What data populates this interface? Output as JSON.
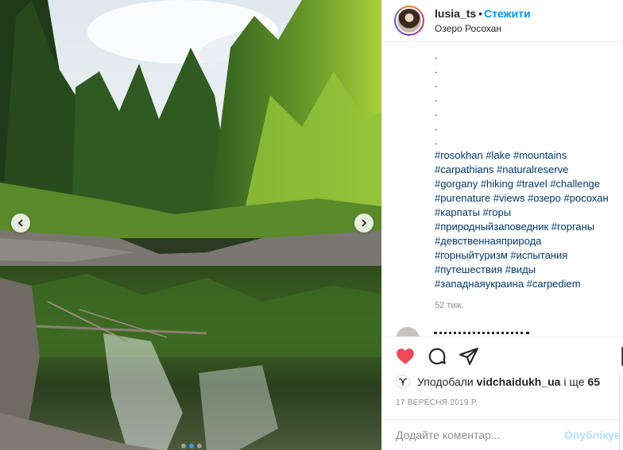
{
  "post": {
    "username": "lusia_ts",
    "separator": "•",
    "follow_label": "Стежити",
    "location": "Озеро Росохан"
  },
  "caption": {
    "dots": [
      ".",
      ".",
      ".",
      ".",
      ".",
      ".",
      "."
    ],
    "hashtag_lines": [
      "#rosokhan #lake #mountains",
      "#carpathians #naturalreserve",
      "#gorgany #hiking #travel #challenge",
      "#purenature #views #озеро #росохан",
      "#карпаты #горы",
      "#природныйзаповедник #горганы",
      "#девственнаяприрода",
      "#горныйтуризм #испытания",
      "#путешествия #виды",
      "#западнаяукраина #carpediem"
    ],
    "age": "52 тиж."
  },
  "likes": {
    "prefix": "Уподобали ",
    "liker": "vidchaidukh_ua",
    "middle": " і ще ",
    "count": "65"
  },
  "date": "17 ВЕРЕСНЯ 2019 Р.",
  "comment": {
    "placeholder": "Додайте коментар...",
    "publish_label": "Опублікувати"
  },
  "icons": {
    "like": "heart-icon",
    "comment": "comment-icon",
    "share": "share-icon",
    "save": "bookmark-icon",
    "prev": "chevron-left-icon",
    "next": "chevron-right-icon"
  },
  "colors": {
    "like": "#ed4956",
    "link": "#00376b",
    "follow": "#0095f6",
    "publish_disabled": "#b2dffc",
    "muted": "#8e8e8e"
  },
  "carousel": {
    "total": 3,
    "active": 1
  }
}
